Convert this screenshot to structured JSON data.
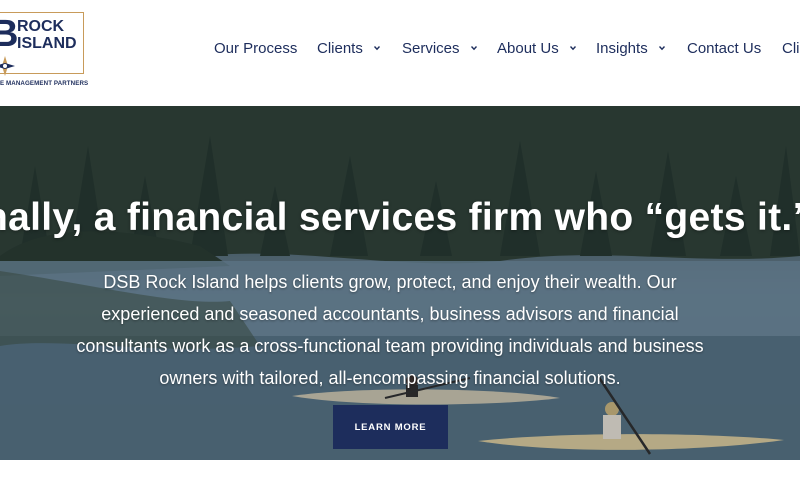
{
  "logo": {
    "letter": "B",
    "line1": "ROCK",
    "line2": "ISLAND",
    "tagline": "E MANAGEMENT PARTNERS",
    "colors": {
      "navy": "#1d2d5c",
      "gold": "#c89b5a"
    }
  },
  "nav": {
    "items": [
      {
        "label": "Our Process",
        "has_dropdown": false
      },
      {
        "label": "Clients",
        "has_dropdown": true
      },
      {
        "label": "Services",
        "has_dropdown": true
      },
      {
        "label": "About Us",
        "has_dropdown": true
      },
      {
        "label": "Insights",
        "has_dropdown": true
      },
      {
        "label": "Contact Us",
        "has_dropdown": false
      },
      {
        "label": "Cli",
        "has_dropdown": false
      }
    ]
  },
  "hero": {
    "headline": "nally, a financial services firm who “gets it.”",
    "body": "DSB Rock Island helps clients grow, protect, and enjoy their wealth. Our experienced and seasoned accountants, business advisors and financial consultants work as a cross-functional team providing individuals and business owners with tailored, all-encompassing financial solutions.",
    "cta_label": "LEARN MORE",
    "image_subject": "kayakers on a forest lake"
  },
  "colors": {
    "nav_text": "#1d2d5c",
    "button_bg": "#1d2d5c",
    "hero_text": "#ffffff"
  }
}
